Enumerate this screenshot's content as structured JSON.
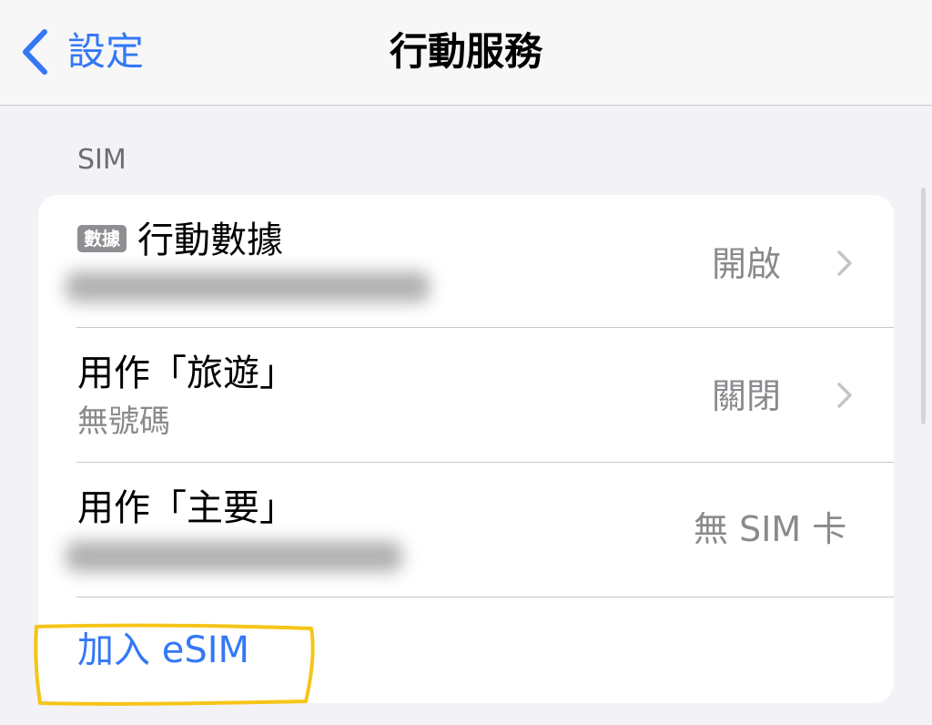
{
  "navbar": {
    "back_label": "設定",
    "title": "行動服務",
    "back_icon": "chevron-left-icon"
  },
  "section": {
    "header": "SIM"
  },
  "rows": [
    {
      "badge": "數據",
      "title": "行動數據",
      "value": "開啟",
      "has_chevron": true,
      "subtitle_redacted": true
    },
    {
      "title": "用作「旅遊」",
      "subtitle": "無號碼",
      "value": "關閉",
      "has_chevron": true
    },
    {
      "title": "用作「主要」",
      "value": "無 SIM 卡",
      "has_chevron": false,
      "subtitle_redacted": true
    }
  ],
  "add_esim": {
    "label": "加入 eSIM"
  },
  "colors": {
    "accent": "#3478f6",
    "background": "#f2f2f7",
    "card": "#ffffff",
    "secondary_text": "#8a8a8e",
    "badge": "#8e8e93",
    "highlight": "#f5c518"
  }
}
